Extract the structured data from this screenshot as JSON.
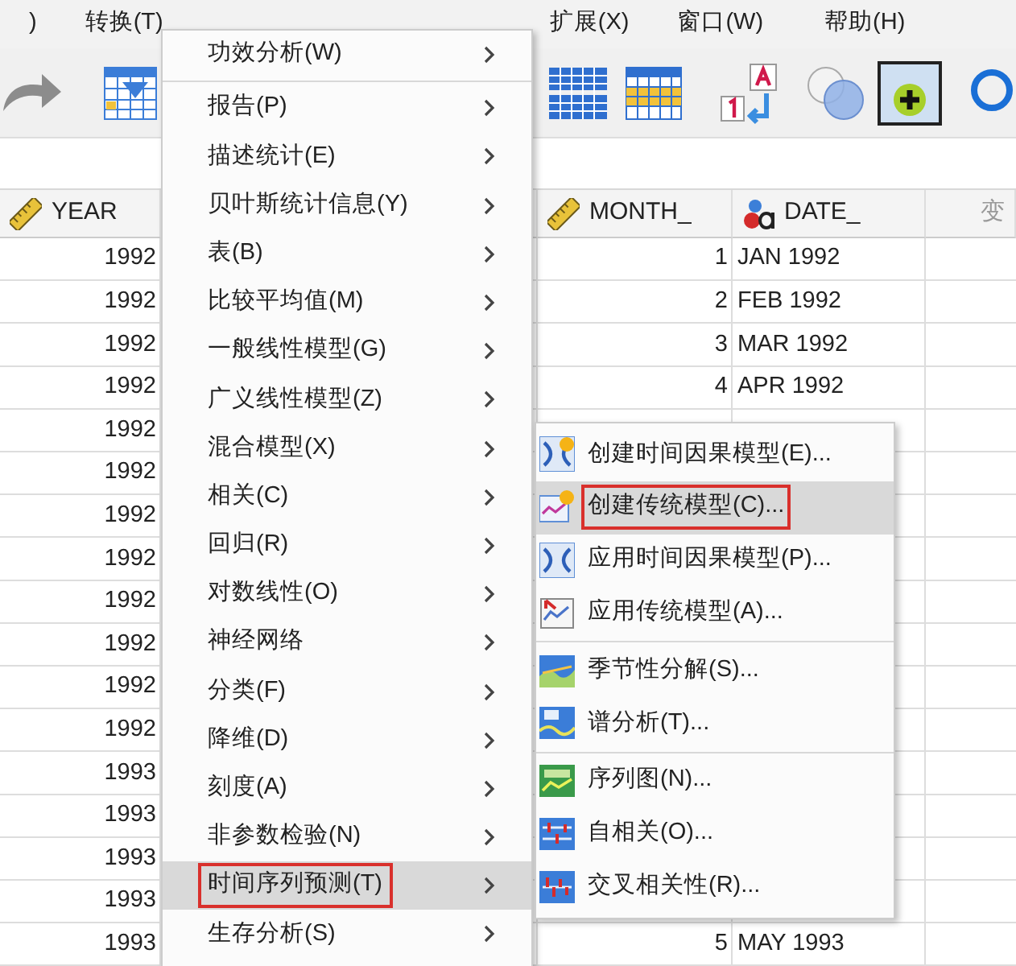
{
  "menubar": [
    {
      "label": ")"
    },
    {
      "label": "转换(T)"
    },
    {
      "label": "扩展(X)"
    },
    {
      "label": "窗口(W)"
    },
    {
      "label": "帮助(H)"
    }
  ],
  "table": {
    "columns": [
      {
        "label": "YEAR",
        "kind": "scale"
      },
      {
        "label": "MONTH_",
        "kind": "scale"
      },
      {
        "label": "DATE_",
        "kind": "nominal"
      },
      {
        "label": "变",
        "kind": "empty"
      }
    ],
    "rows": [
      {
        "year": "1992",
        "month": "1",
        "date": "JAN 1992"
      },
      {
        "year": "1992",
        "month": "2",
        "date": "FEB 1992"
      },
      {
        "year": "1992",
        "month": "3",
        "date": "MAR 1992"
      },
      {
        "year": "1992",
        "month": "4",
        "date": "APR 1992"
      },
      {
        "year": "1992"
      },
      {
        "year": "1992"
      },
      {
        "year": "1992"
      },
      {
        "year": "1992"
      },
      {
        "year": "1992"
      },
      {
        "year": "1992"
      },
      {
        "year": "1992"
      },
      {
        "year": "1992"
      },
      {
        "year": "1993"
      },
      {
        "year": "1993"
      },
      {
        "year": "1993"
      },
      {
        "year": "1993"
      },
      {
        "year": "1993",
        "month": "5",
        "date": "MAY 1993"
      }
    ]
  },
  "analyze_menu": {
    "groups": [
      [
        {
          "label": "功效分析(W)",
          "selected": false,
          "highlighted": false
        }
      ],
      [
        {
          "label": "报告(P)",
          "selected": false,
          "highlighted": false
        },
        {
          "label": "描述统计(E)",
          "selected": false,
          "highlighted": false
        },
        {
          "label": "贝叶斯统计信息(Y)",
          "selected": false,
          "highlighted": false
        },
        {
          "label": "表(B)",
          "selected": false,
          "highlighted": false
        },
        {
          "label": "比较平均值(M)",
          "selected": false,
          "highlighted": false
        },
        {
          "label": "一般线性模型(G)",
          "selected": false,
          "highlighted": false
        },
        {
          "label": "广义线性模型(Z)",
          "selected": false,
          "highlighted": false
        },
        {
          "label": "混合模型(X)",
          "selected": false,
          "highlighted": false
        },
        {
          "label": "相关(C)",
          "selected": false,
          "highlighted": false
        },
        {
          "label": "回归(R)",
          "selected": false,
          "highlighted": false
        },
        {
          "label": "对数线性(O)",
          "selected": false,
          "highlighted": false
        },
        {
          "label": "神经网络",
          "selected": false,
          "highlighted": false
        },
        {
          "label": "分类(F)",
          "selected": false,
          "highlighted": false
        },
        {
          "label": "降维(D)",
          "selected": false,
          "highlighted": false
        },
        {
          "label": "刻度(A)",
          "selected": false,
          "highlighted": false
        },
        {
          "label": "非参数检验(N)",
          "selected": false,
          "highlighted": false
        },
        {
          "label": "时间序列预测(T)",
          "selected": true,
          "highlighted": true
        },
        {
          "label": "生存分析(S)",
          "selected": false,
          "highlighted": false
        }
      ]
    ]
  },
  "forecast_submenu": {
    "groups": [
      [
        {
          "label": "创建时间因果模型(E)...",
          "kind": "causal",
          "selected": false,
          "highlighted": false
        },
        {
          "label": "创建传统模型(C)...",
          "kind": "traditional",
          "selected": true,
          "highlighted": true
        },
        {
          "label": "应用时间因果模型(P)...",
          "kind": "apply-causal",
          "selected": false,
          "highlighted": false
        },
        {
          "label": "应用传统模型(A)...",
          "kind": "apply-traditional",
          "selected": false,
          "highlighted": false
        }
      ],
      [
        {
          "label": "季节性分解(S)...",
          "kind": "seasonal",
          "selected": false,
          "highlighted": false
        },
        {
          "label": "谱分析(T)...",
          "kind": "spectral",
          "selected": false,
          "highlighted": false
        }
      ],
      [
        {
          "label": "序列图(N)...",
          "kind": "sequence",
          "selected": false,
          "highlighted": false
        },
        {
          "label": "自相关(O)...",
          "kind": "autocorr",
          "selected": false,
          "highlighted": false
        },
        {
          "label": "交叉相关性(R)...",
          "kind": "crosscorr",
          "selected": false,
          "highlighted": false
        }
      ]
    ]
  }
}
